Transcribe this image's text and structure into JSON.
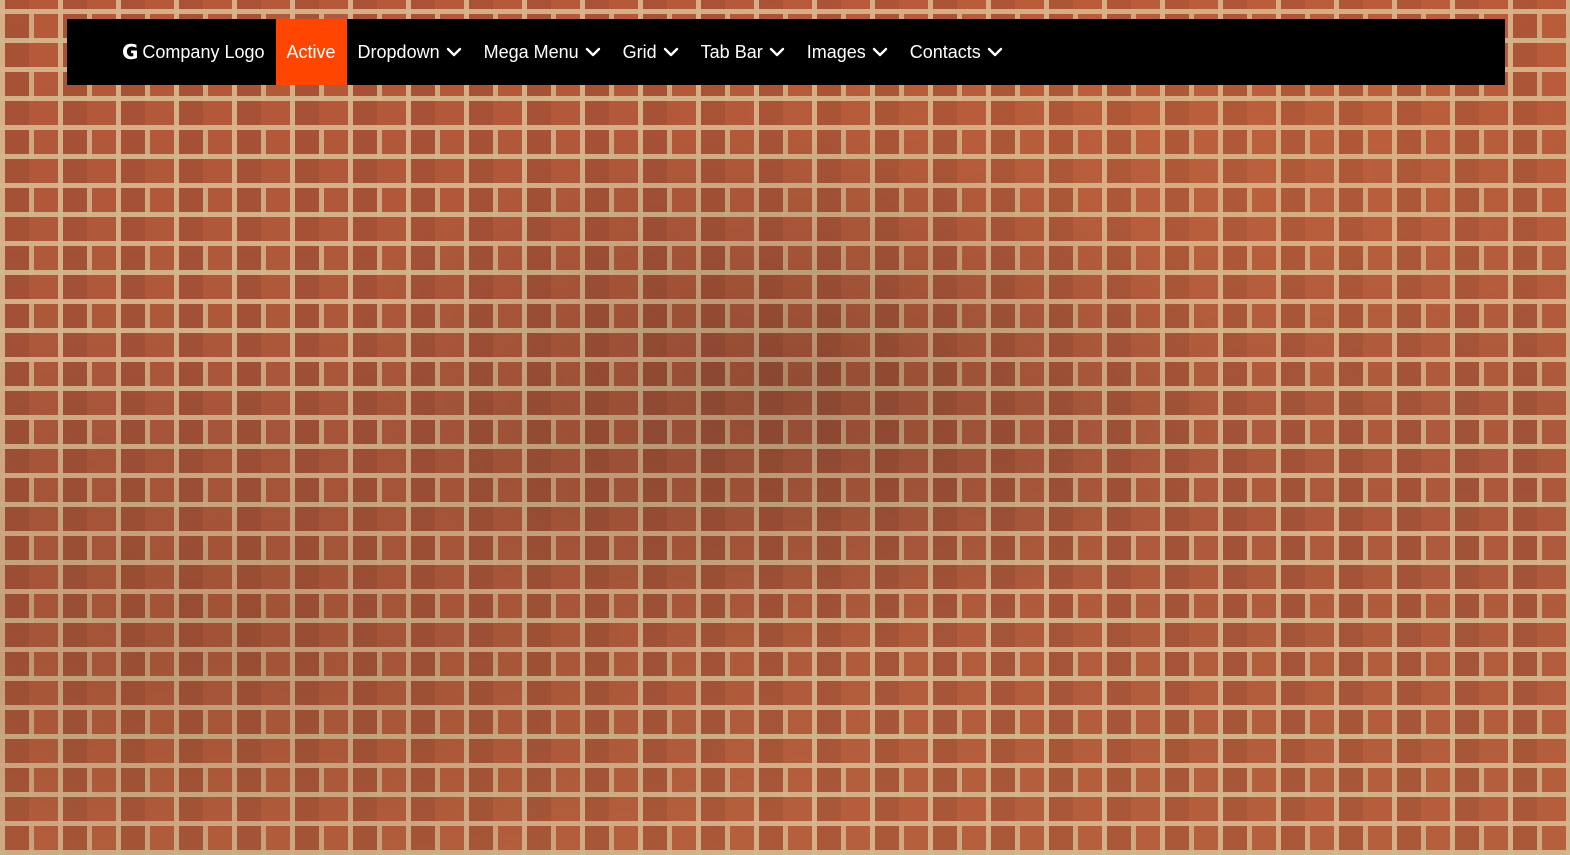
{
  "page": {
    "background": "brick-wall",
    "accent_color": "#ff4500",
    "navbar_color": "#000000"
  },
  "navbar": {
    "brand": {
      "icon": "google-g-icon",
      "label": "Company Logo"
    },
    "items": [
      {
        "label": "Active",
        "active": true,
        "dropdown": false
      },
      {
        "label": "Dropdown",
        "active": false,
        "dropdown": true,
        "icon": "chevron-down-icon"
      },
      {
        "label": "Mega Menu",
        "active": false,
        "dropdown": true,
        "icon": "chevron-down-icon"
      },
      {
        "label": "Grid",
        "active": false,
        "dropdown": true,
        "icon": "chevron-down-icon"
      },
      {
        "label": "Tab Bar",
        "active": false,
        "dropdown": true,
        "icon": "chevron-down-icon"
      },
      {
        "label": "Images",
        "active": false,
        "dropdown": true,
        "icon": "chevron-down-icon"
      },
      {
        "label": "Contacts",
        "active": false,
        "dropdown": true,
        "icon": "chevron-down-icon"
      }
    ]
  }
}
